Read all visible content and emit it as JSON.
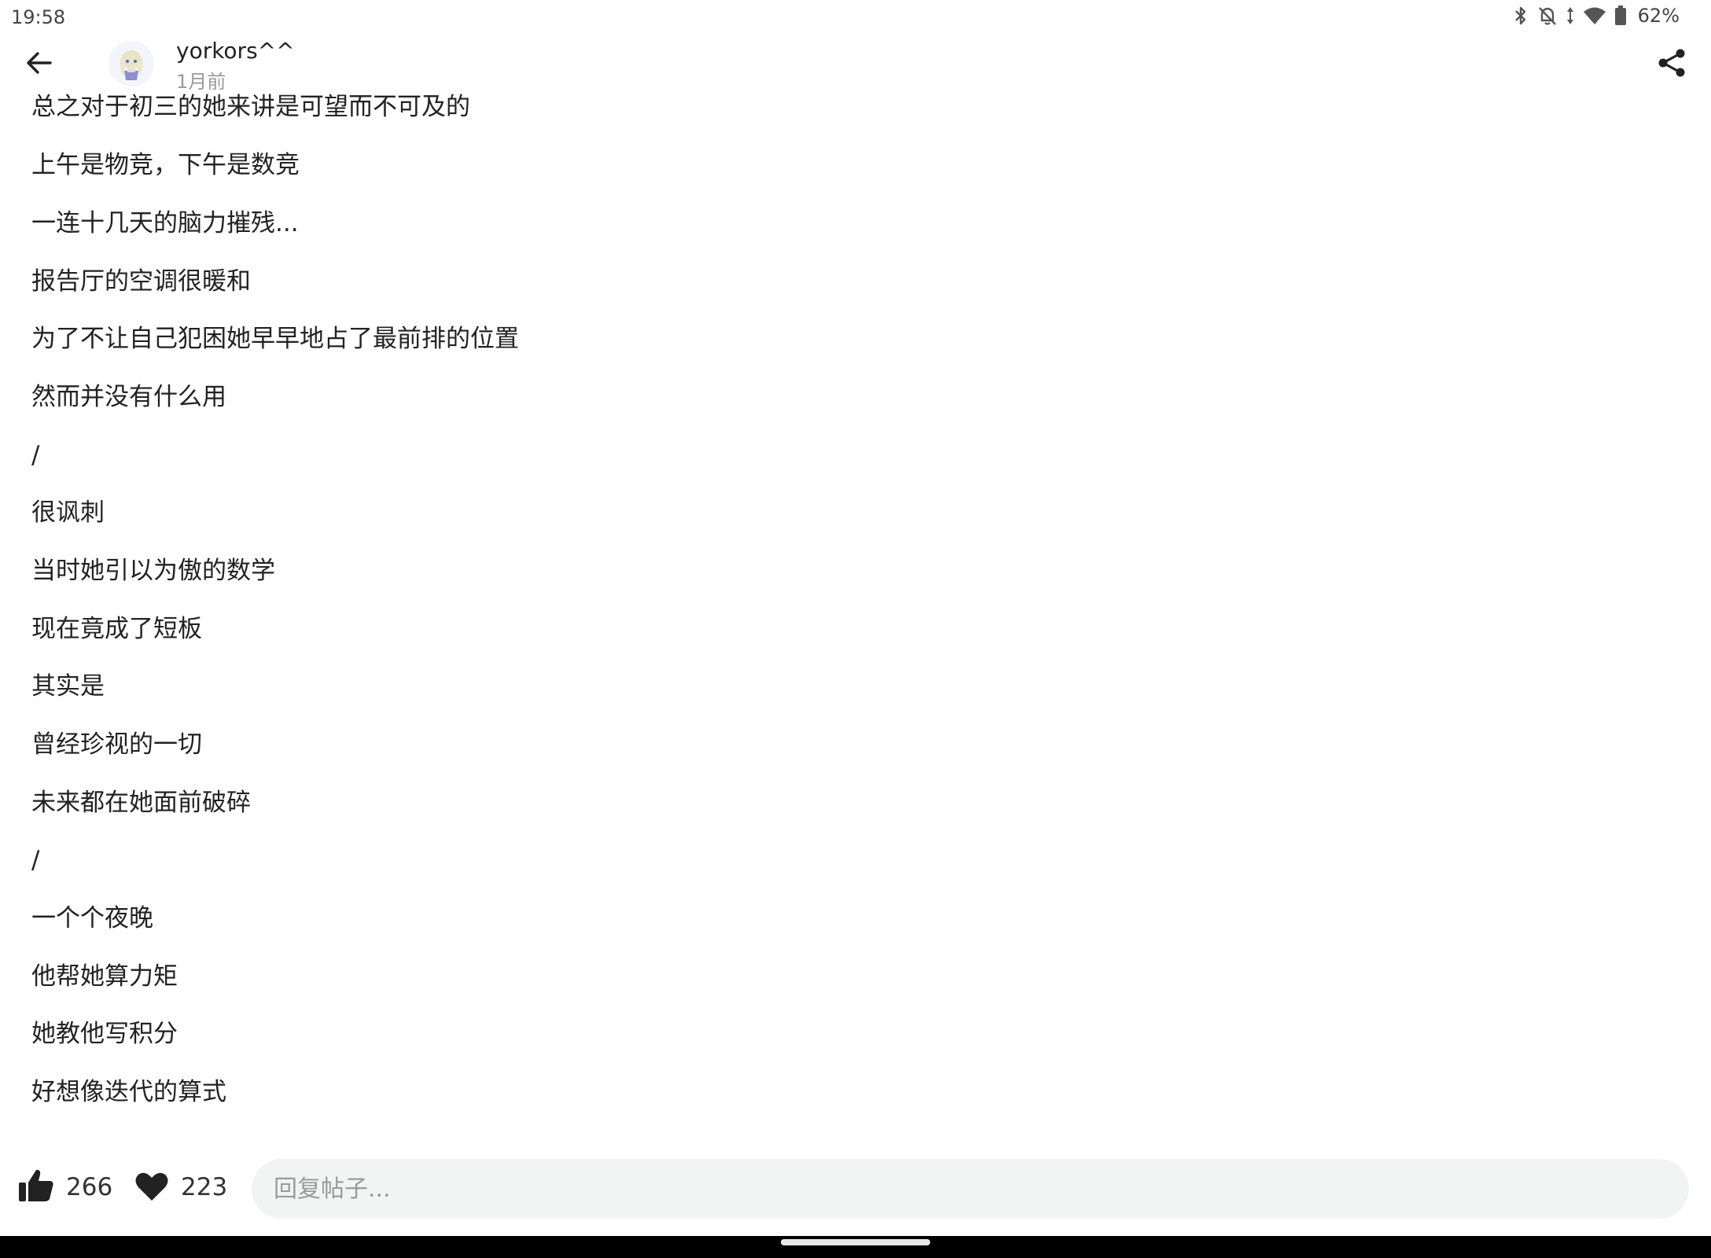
{
  "status_bar": {
    "time": "19:58",
    "battery": "62%",
    "icons": [
      "bluetooth-icon",
      "bell-muted-icon",
      "data-arrows-icon",
      "wifi-icon",
      "battery-icon"
    ]
  },
  "header": {
    "username": "yorkors^^",
    "post_time": "1月前",
    "back_icon": "arrow-left-icon",
    "share_icon": "share-icon"
  },
  "post": {
    "lines": [
      "总之对于初三的她来讲是可望而不可及的",
      "上午是物竞，下午是数竞",
      "一连十几天的脑力摧残...",
      "报告厅的空调很暖和",
      "为了不让自己犯困她早早地占了最前排的位置",
      "然而并没有什么用",
      "/",
      "很讽刺",
      "当时她引以为傲的数学",
      "现在竟成了短板",
      "其实是",
      "曾经珍视的一切",
      "未来都在她面前破碎",
      "/",
      "一个个夜晚",
      "他帮她算力矩",
      "她教他写积分",
      "好想像迭代的算式"
    ]
  },
  "actions": {
    "like_count": "266",
    "favorite_count": "223",
    "reply_placeholder": "回复帖子...",
    "accent_color": "#222222"
  }
}
